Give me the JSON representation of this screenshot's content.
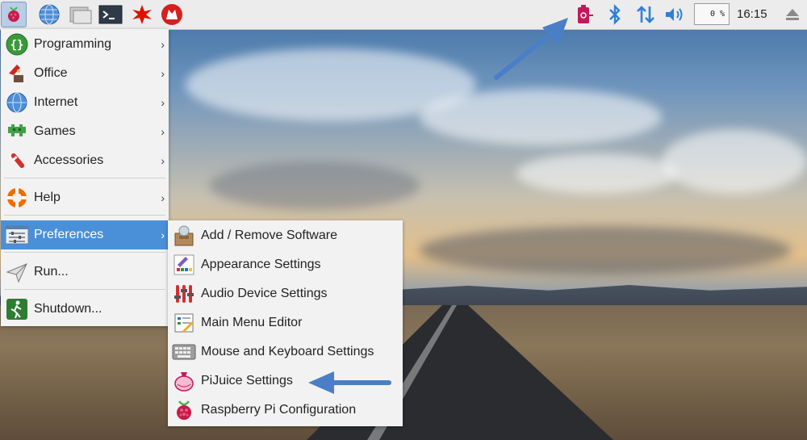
{
  "taskbar": {
    "icons": [
      "raspberry-menu-icon",
      "web-browser-icon",
      "file-manager-icon",
      "terminal-icon",
      "mathematica-icon",
      "wolfram-icon"
    ],
    "tray_icons": [
      "pijuice-battery-icon",
      "bluetooth-icon",
      "network-transfer-icon",
      "volume-icon"
    ],
    "cpu_usage": "0 %",
    "clock": "16:15",
    "eject_icon": "eject-icon"
  },
  "main_menu": {
    "items": [
      {
        "label": "Programming",
        "icon": "programming-icon"
      },
      {
        "label": "Office",
        "icon": "office-icon"
      },
      {
        "label": "Internet",
        "icon": "internet-icon"
      },
      {
        "label": "Games",
        "icon": "games-icon"
      },
      {
        "label": "Accessories",
        "icon": "accessories-icon"
      },
      {
        "label": "Help",
        "icon": "help-icon"
      },
      {
        "label": "Preferences",
        "icon": "preferences-icon"
      },
      {
        "label": "Run...",
        "icon": "run-icon"
      },
      {
        "label": "Shutdown...",
        "icon": "shutdown-icon"
      }
    ],
    "arrow": "›"
  },
  "preferences_menu": {
    "items": [
      {
        "label": "Add / Remove Software",
        "icon": "software-box-icon"
      },
      {
        "label": "Appearance Settings",
        "icon": "appearance-icon"
      },
      {
        "label": "Audio Device Settings",
        "icon": "audio-mixer-icon"
      },
      {
        "label": "Main Menu Editor",
        "icon": "menu-editor-icon"
      },
      {
        "label": "Mouse and Keyboard Settings",
        "icon": "keyboard-icon"
      },
      {
        "label": "PiJuice Settings",
        "icon": "pijuice-icon"
      },
      {
        "label": "Raspberry Pi Configuration",
        "icon": "raspberry-config-icon"
      }
    ]
  },
  "colors": {
    "highlight": "#4a90d9",
    "annotation_arrow": "#4a7fc8"
  }
}
